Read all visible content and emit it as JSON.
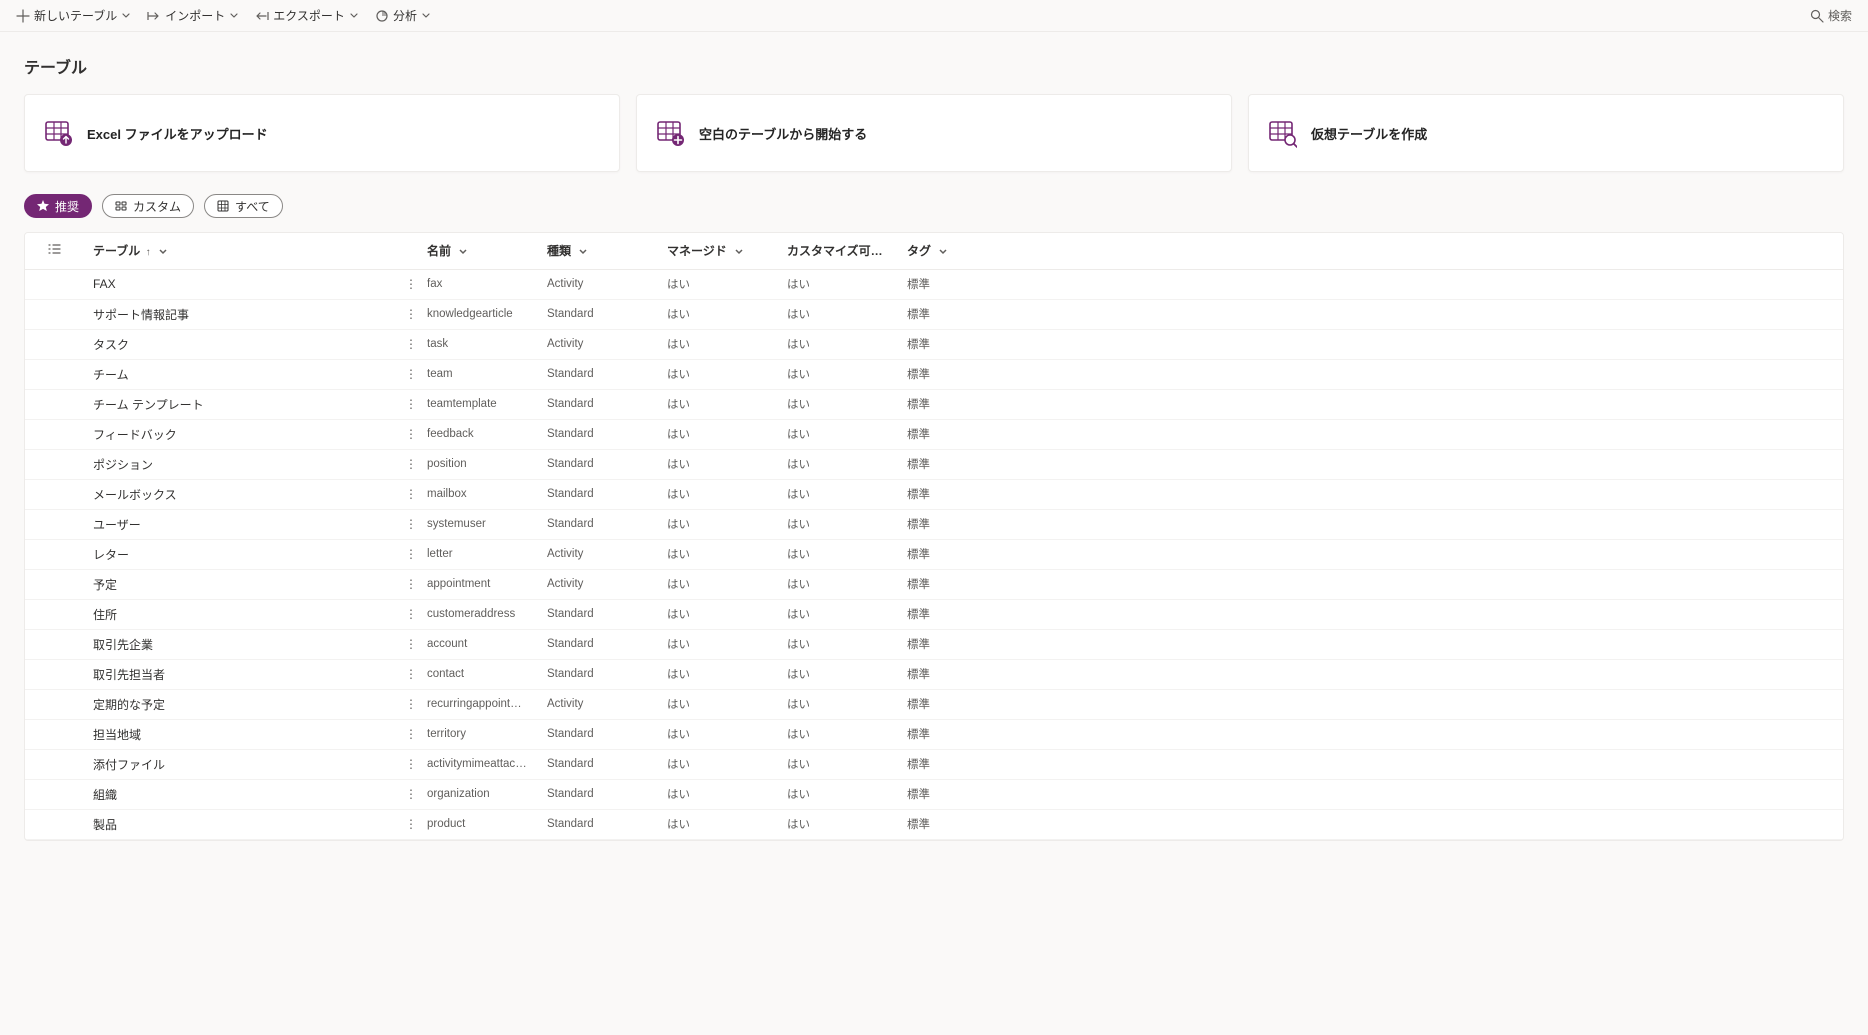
{
  "commandbar": {
    "new_table": "新しいテーブル",
    "import": "インポート",
    "export": "エクスポート",
    "analyze": "分析",
    "search": "検索"
  },
  "page_title": "テーブル",
  "cards": {
    "upload_excel": "Excel ファイルをアップロード",
    "blank_table": "空白のテーブルから開始する",
    "virtual_table": "仮想テーブルを作成"
  },
  "pills": {
    "recommended": "推奨",
    "custom": "カスタム",
    "all": "すべて"
  },
  "columns": {
    "table": "テーブル",
    "name": "名前",
    "type": "種類",
    "managed": "マネージド",
    "customizable": "カスタマイズ可能",
    "tag": "タグ"
  },
  "rows": [
    {
      "table": "FAX",
      "name": "fax",
      "type": "Activity",
      "managed": "はい",
      "custom": "はい",
      "tag": "標準"
    },
    {
      "table": "サポート情報記事",
      "name": "knowledgearticle",
      "type": "Standard",
      "managed": "はい",
      "custom": "はい",
      "tag": "標準"
    },
    {
      "table": "タスク",
      "name": "task",
      "type": "Activity",
      "managed": "はい",
      "custom": "はい",
      "tag": "標準"
    },
    {
      "table": "チーム",
      "name": "team",
      "type": "Standard",
      "managed": "はい",
      "custom": "はい",
      "tag": "標準"
    },
    {
      "table": "チーム テンプレート",
      "name": "teamtemplate",
      "type": "Standard",
      "managed": "はい",
      "custom": "はい",
      "tag": "標準"
    },
    {
      "table": "フィードバック",
      "name": "feedback",
      "type": "Standard",
      "managed": "はい",
      "custom": "はい",
      "tag": "標準"
    },
    {
      "table": "ポジション",
      "name": "position",
      "type": "Standard",
      "managed": "はい",
      "custom": "はい",
      "tag": "標準"
    },
    {
      "table": "メールボックス",
      "name": "mailbox",
      "type": "Standard",
      "managed": "はい",
      "custom": "はい",
      "tag": "標準"
    },
    {
      "table": "ユーザー",
      "name": "systemuser",
      "type": "Standard",
      "managed": "はい",
      "custom": "はい",
      "tag": "標準"
    },
    {
      "table": "レター",
      "name": "letter",
      "type": "Activity",
      "managed": "はい",
      "custom": "はい",
      "tag": "標準"
    },
    {
      "table": "予定",
      "name": "appointment",
      "type": "Activity",
      "managed": "はい",
      "custom": "はい",
      "tag": "標準"
    },
    {
      "table": "住所",
      "name": "customeraddress",
      "type": "Standard",
      "managed": "はい",
      "custom": "はい",
      "tag": "標準"
    },
    {
      "table": "取引先企業",
      "name": "account",
      "type": "Standard",
      "managed": "はい",
      "custom": "はい",
      "tag": "標準"
    },
    {
      "table": "取引先担当者",
      "name": "contact",
      "type": "Standard",
      "managed": "はい",
      "custom": "はい",
      "tag": "標準"
    },
    {
      "table": "定期的な予定",
      "name": "recurringappointmentmas...",
      "type": "Activity",
      "managed": "はい",
      "custom": "はい",
      "tag": "標準"
    },
    {
      "table": "担当地域",
      "name": "territory",
      "type": "Standard",
      "managed": "はい",
      "custom": "はい",
      "tag": "標準"
    },
    {
      "table": "添付ファイル",
      "name": "activitymimeattachment",
      "type": "Standard",
      "managed": "はい",
      "custom": "はい",
      "tag": "標準"
    },
    {
      "table": "組織",
      "name": "organization",
      "type": "Standard",
      "managed": "はい",
      "custom": "はい",
      "tag": "標準"
    },
    {
      "table": "製品",
      "name": "product",
      "type": "Standard",
      "managed": "はい",
      "custom": "はい",
      "tag": "標準"
    }
  ],
  "accent": "#742774"
}
